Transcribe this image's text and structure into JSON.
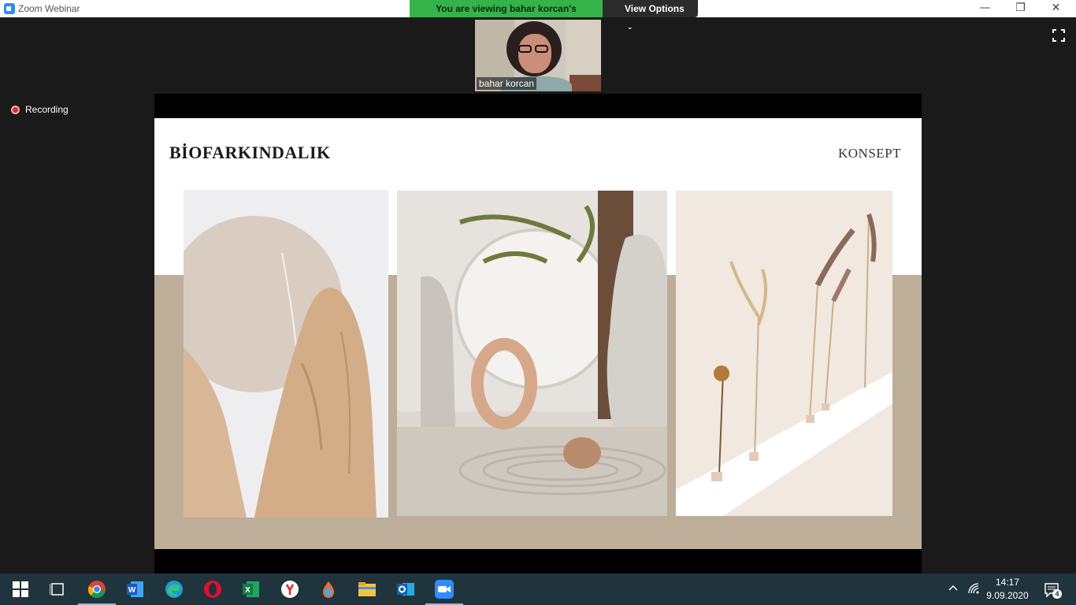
{
  "window": {
    "title": "Zoom Webinar"
  },
  "banner": {
    "viewing_text": "You are viewing bahar korcan's screen",
    "view_options_label": "View Options"
  },
  "recording": {
    "label": "Recording"
  },
  "video": {
    "participant_name": "bahar korcan"
  },
  "slide": {
    "title": "BİOFARKINDALIK",
    "tag": "KONSEPT"
  },
  "taskbar": {
    "apps": [
      "start",
      "task-view",
      "chrome",
      "word",
      "edge",
      "opera",
      "excel",
      "yandex",
      "paint",
      "file-explorer",
      "outlook",
      "zoom"
    ],
    "time": "14:17",
    "date": "9.09.2020",
    "notification_count": "4"
  },
  "colors": {
    "banner_green": "#35b34a",
    "slide_band": "#bcae98",
    "taskbar": "#20343e"
  }
}
